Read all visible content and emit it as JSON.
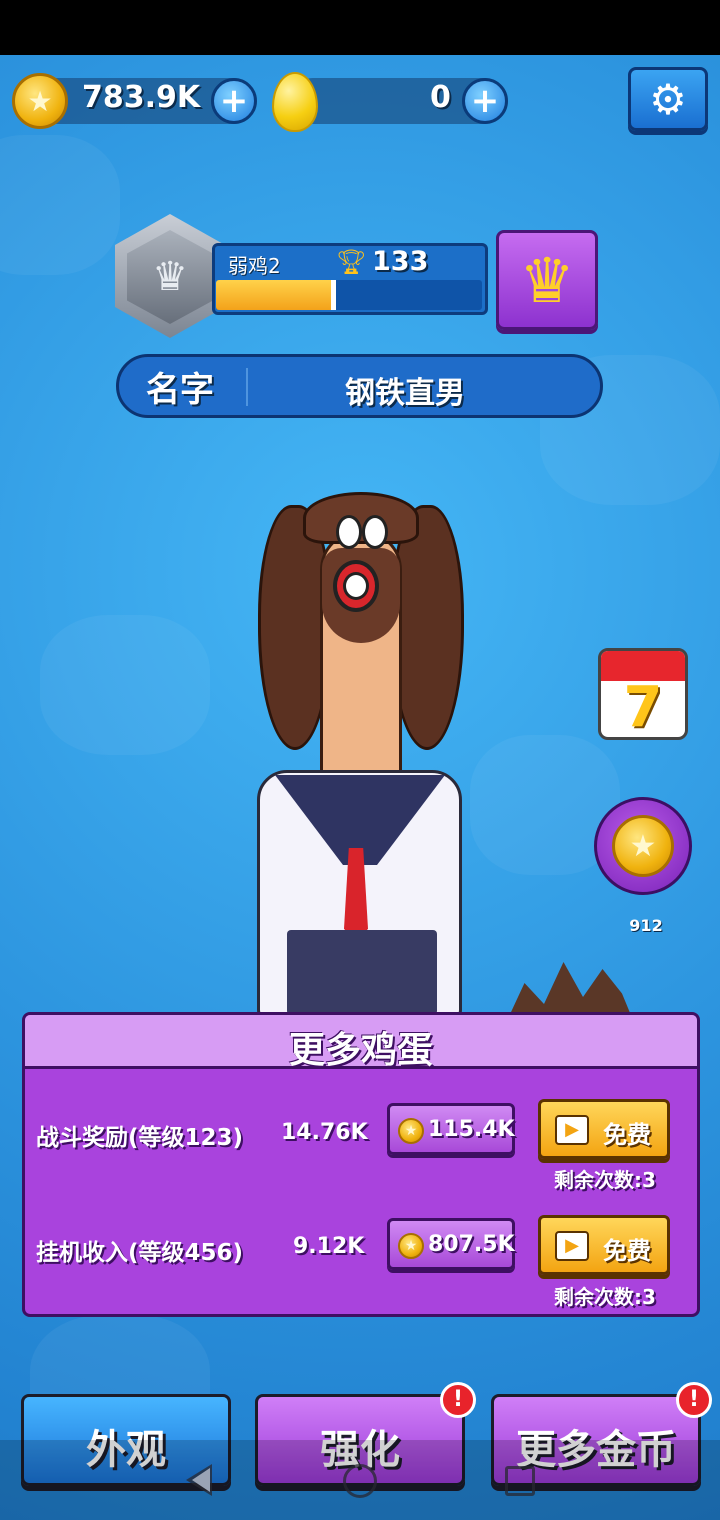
{
  "currency": {
    "coins": "783.9K",
    "eggs": "0",
    "coin_icon": "star-coin-icon",
    "egg_icon": "golden-egg-icon",
    "plus_icon": "plus-icon"
  },
  "settings": {
    "icon": "gear-icon"
  },
  "rank": {
    "name": "弱鸡2",
    "trophies": "133",
    "progress": 0.45,
    "badge_icon": "silver-crown-badge-icon",
    "trophy_icon": "trophy-icon",
    "crown_button_icon": "crown-icon"
  },
  "profile": {
    "name_label": "名字",
    "name_value": "钢铁直男"
  },
  "side": {
    "calendar_number": "7",
    "coin_offer_count": "912"
  },
  "panel": {
    "title": "更多鸡蛋",
    "rows": [
      {
        "label": "战斗奖励(等级123)",
        "value": "14.76K",
        "price": "115.4K",
        "free_label": "免费",
        "remaining": "剩余次数:3"
      },
      {
        "label": "挂机收入(等级456)",
        "value": "9.12K",
        "price": "807.5K",
        "free_label": "免费",
        "remaining": "剩余次数:3"
      }
    ]
  },
  "bottom": {
    "look": "外观",
    "upgrade": "强化",
    "more_coins": "更多金币",
    "alert": "!"
  },
  "colors": {
    "background": "#2f9be3",
    "panel": "#a943dd",
    "free_button": "#f3a412"
  }
}
